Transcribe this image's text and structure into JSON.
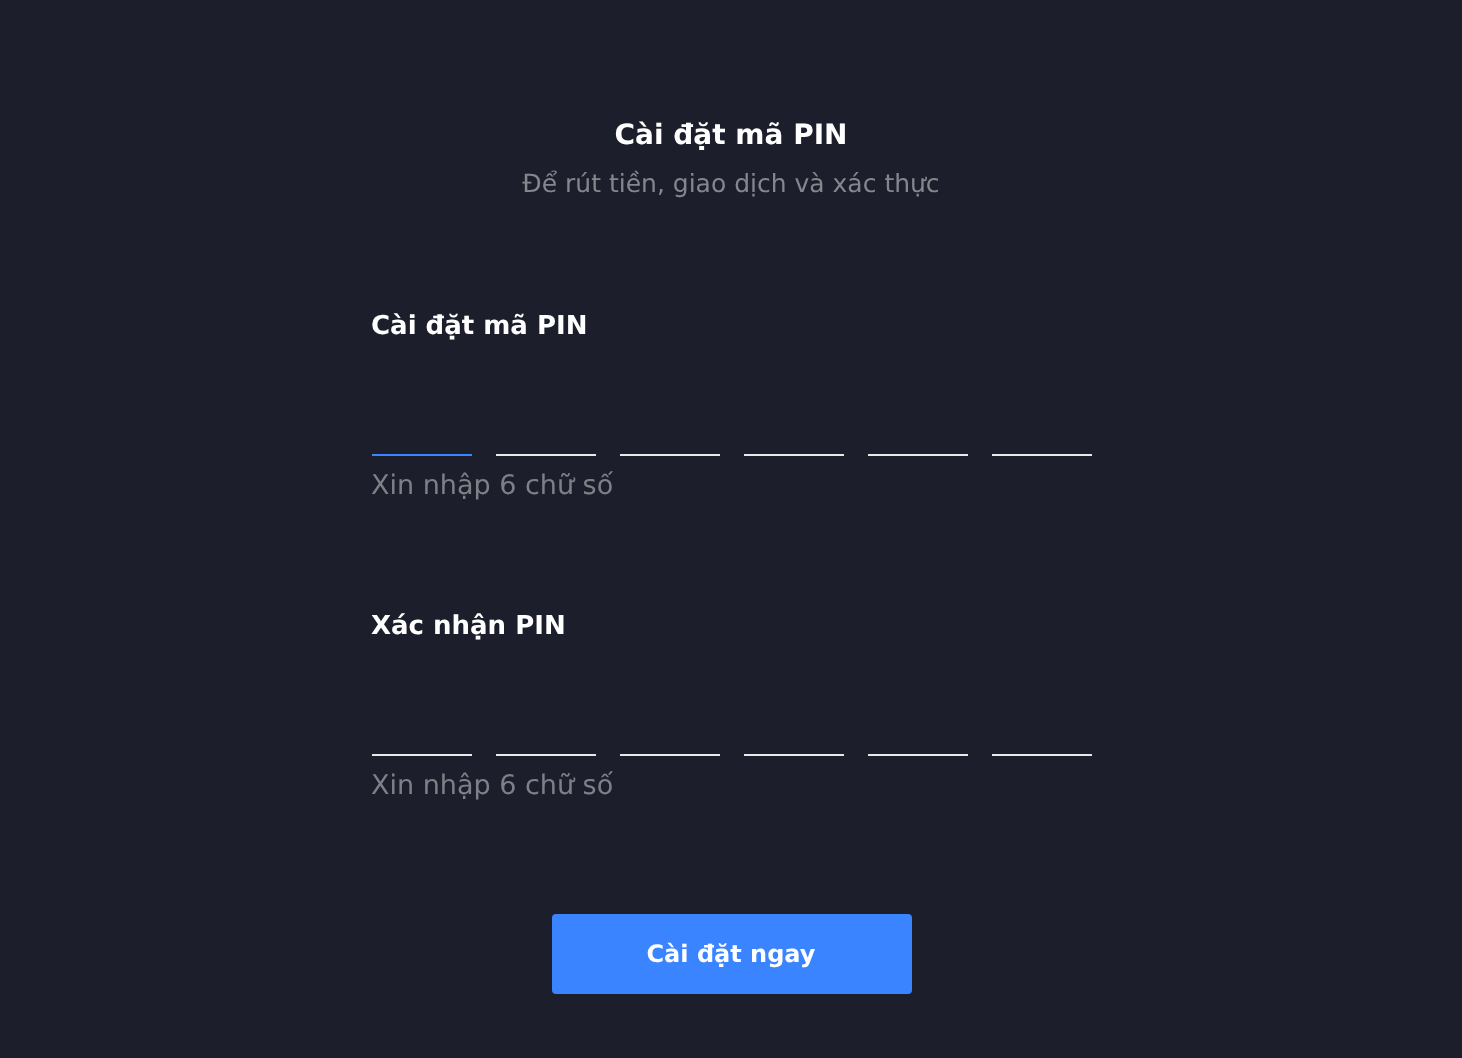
{
  "header": {
    "title": "Cài đặt mã PIN",
    "subtitle": "Để rút tiền, giao dịch và xác thực"
  },
  "fields": [
    {
      "label": "Cài đặt mã PIN",
      "hint": "Xin nhập 6 chữ số",
      "digits": [
        {
          "focused": true
        },
        {
          "focused": false
        },
        {
          "focused": false
        },
        {
          "focused": false
        },
        {
          "focused": false
        },
        {
          "focused": false
        }
      ]
    },
    {
      "label": "Xác nhận PIN",
      "hint": "Xin nhập 6 chữ số",
      "digits": [
        {
          "focused": false
        },
        {
          "focused": false
        },
        {
          "focused": false
        },
        {
          "focused": false
        },
        {
          "focused": false
        },
        {
          "focused": false
        }
      ]
    }
  ],
  "submit_button": "Cài đặt ngay"
}
